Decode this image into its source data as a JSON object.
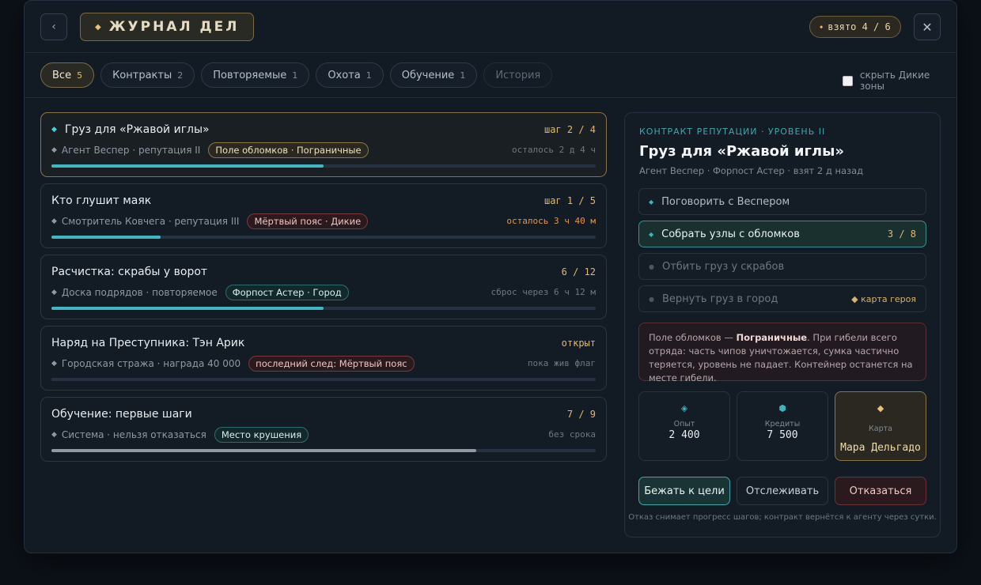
{
  "header": {
    "title": "ЖУРНАЛ ДЕЛ",
    "taken_label": "взято 4 / 6"
  },
  "tabs": [
    {
      "label": "Все",
      "count": "5",
      "state": "active"
    },
    {
      "label": "Контракты",
      "count": "2",
      "state": "normal"
    },
    {
      "label": "Повторяемые",
      "count": "1",
      "state": "normal"
    },
    {
      "label": "Охота",
      "count": "1",
      "state": "normal"
    },
    {
      "label": "Обучение",
      "count": "1",
      "state": "normal"
    },
    {
      "label": "История",
      "count": "",
      "state": "disabled"
    }
  ],
  "toggle": {
    "label": "скрыть Дикие зоны",
    "checked": false
  },
  "quests": [
    {
      "title": "Груз для «Ржавой иглы»",
      "step": "шаг 2 / 4",
      "giver": "Агент Веспер · репутация II",
      "tag": "Поле обломков · Пограничные",
      "tag_style": "amber",
      "right": "осталось 2 д 4 ч",
      "progress": 0.5,
      "selected": true
    },
    {
      "title": "Кто глушит маяк",
      "step": "шаг 1 / 5",
      "giver": "Смотритель Ковчега · репутация III",
      "tag": "Мёртвый пояс · Дикие",
      "tag_style": "red",
      "right": "осталось 3 ч 40 м",
      "right_warn": true,
      "progress": 0.2
    },
    {
      "title": "Расчистка: скрабы у ворот",
      "step": "6 / 12",
      "giver": "Доска подрядов · повторяемое",
      "tag": "Форпост Астер · Город",
      "tag_style": "teal",
      "right": "сброс через 6 ч 12 м",
      "progress": 0.5
    },
    {
      "title": "Наряд на Преступника: Тэн Арик",
      "step": "открыт",
      "giver": "Городская стража · награда 40 000",
      "tag": "последний след: Мёртвый пояс",
      "tag_style": "red",
      "right": "пока жив флаг",
      "progress": 0
    },
    {
      "title": "Обучение: первые шаги",
      "step": "7 / 9",
      "giver": "Система · нельзя отказаться",
      "tag": "Место крушения",
      "tag_style": "teal",
      "right": "без срока",
      "progress": 0.78,
      "bar_style": "gray"
    }
  ],
  "detail": {
    "kicker": "КОНТРАКТ РЕПУТАЦИИ · УРОВЕНЬ II",
    "title": "Груз для «Ржавой иглы»",
    "subtitle": "Агент Веспер · Форпост Астер · взят 2 д назад",
    "steps": [
      {
        "label": "Поговорить с Веспером",
        "state": "done"
      },
      {
        "label": "Собрать узлы с обломков",
        "state": "current",
        "count": "3 / 8"
      },
      {
        "label": "Отбить груз у скрабов",
        "state": "future"
      },
      {
        "label": "Вернуть груз в город",
        "state": "future",
        "note": "карта героя"
      }
    ],
    "warning": {
      "prefix": "Поле обломков — ",
      "bold": "Пограничные",
      "text": ". При гибели всего отряда: часть чипов уничтожается, сумка частично теряется, уровень не падает. Контейнер останется на месте гибели."
    },
    "rewards": [
      {
        "label": "Опыт",
        "value": "2 400",
        "icon": "xp-diamond-icon"
      },
      {
        "label": "Кредиты",
        "value": "7 500",
        "icon": "credits-hex-icon"
      },
      {
        "label": "Карта",
        "value": "Мара Дельгадо",
        "icon": "card-diamond-icon"
      }
    ],
    "buttons": {
      "go": "Бежать к цели",
      "track": "Отслеживать",
      "abandon": "Отказаться"
    },
    "footnote": "Отказ снимает прогресс шагов; контракт вернётся к агенту через сутки."
  },
  "colors": {
    "accent_teal": "#41b7c4",
    "accent_gold": "#e4b869",
    "danger": "#7a3a3d"
  }
}
